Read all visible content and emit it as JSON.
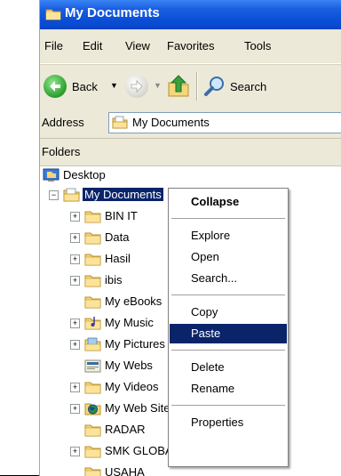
{
  "window": {
    "title": "My Documents"
  },
  "menubar": {
    "items": [
      "File",
      "Edit",
      "View",
      "Favorites",
      "Tools"
    ]
  },
  "toolbar": {
    "back_label": "Back",
    "search_label": "Search"
  },
  "addressbar": {
    "label": "Address",
    "value": "My Documents"
  },
  "folders_pane": {
    "label": "Folders"
  },
  "tree": {
    "root": "Desktop",
    "selected": "My Documents",
    "children": [
      "BIN IT",
      "Data",
      "Hasil",
      "ibis",
      "My eBooks",
      "My Music",
      "My Pictures",
      "My Webs",
      "My Videos",
      "My Web Sites",
      "RADAR",
      "SMK GLOBAL",
      "USAHA"
    ]
  },
  "context_menu": {
    "items": [
      "Collapse",
      "Explore",
      "Open",
      "Search...",
      "Copy",
      "Paste",
      "Delete",
      "Rename",
      "Properties"
    ],
    "highlighted": "Paste"
  },
  "colors": {
    "titlebar": "#0a4ed6",
    "selection": "#0a246a",
    "chrome": "#ece9d8"
  }
}
